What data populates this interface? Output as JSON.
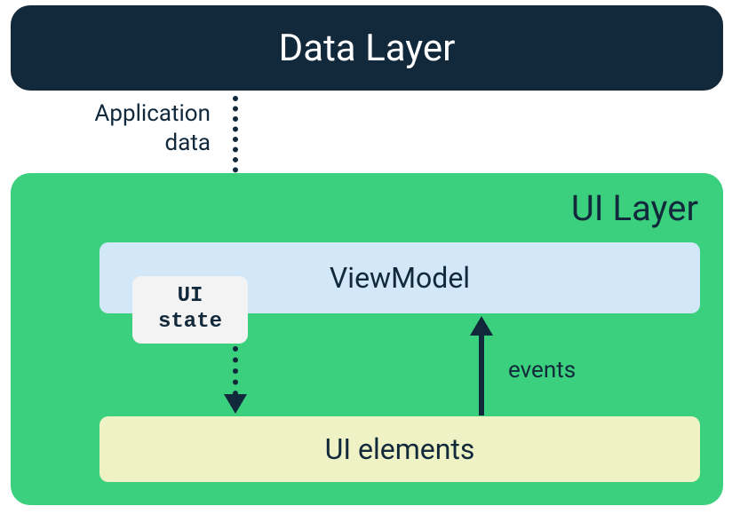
{
  "dataLayer": {
    "label": "Data Layer"
  },
  "arrows": {
    "appData": "Application\ndata",
    "events": "events"
  },
  "uiLayer": {
    "label": "UI Layer",
    "viewModel": {
      "label": "ViewModel",
      "uiStateBadge": "UI\nstate"
    },
    "uiElements": {
      "label": "UI elements"
    }
  },
  "colors": {
    "dataLayerBg": "#12283b",
    "uiLayerBg": "#3bd07d",
    "viewModelBg": "#d2e7f7",
    "uiElementsBg": "#eef2c4",
    "uiStateBadgeBg": "#f3f3f3"
  }
}
